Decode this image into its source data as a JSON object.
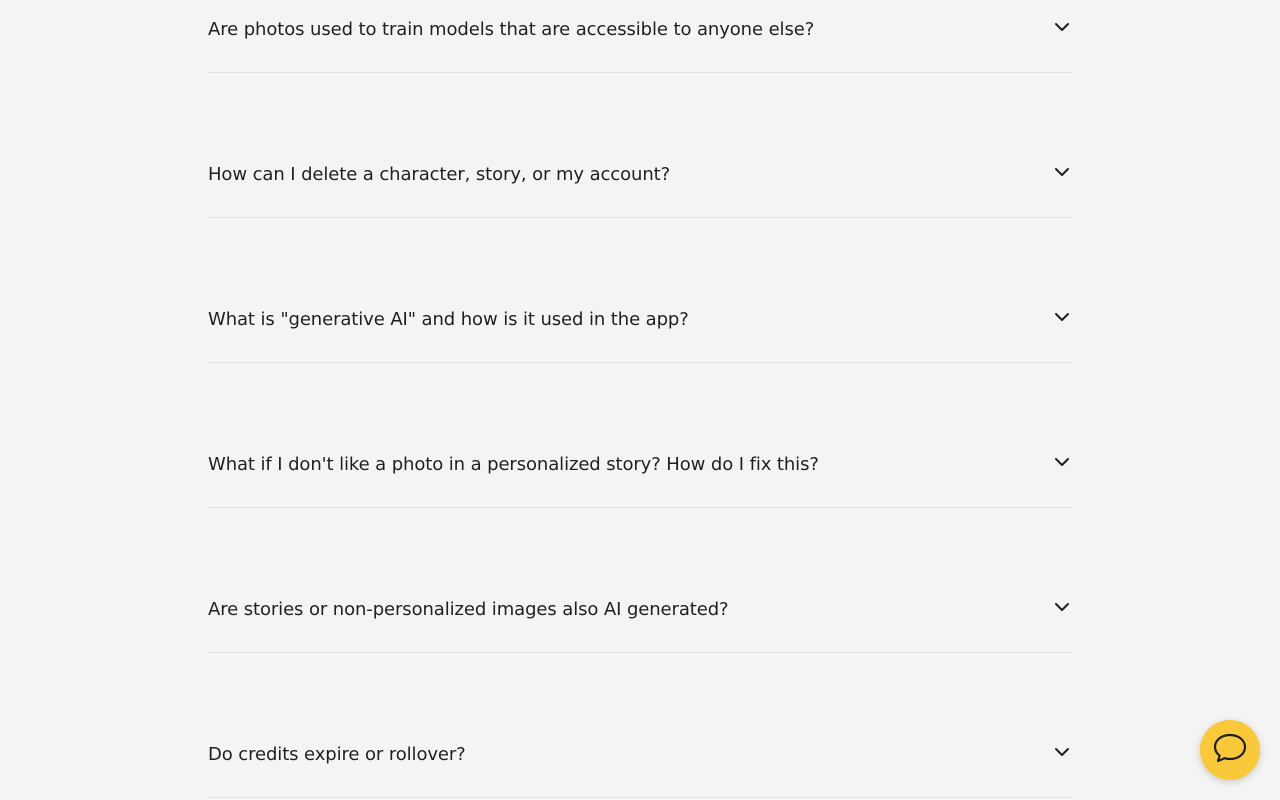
{
  "faq": {
    "items": [
      {
        "question": "Are photos used to train models that are accessible to anyone else?",
        "icon": "chevron-down-icon"
      },
      {
        "question": "How can I delete a character, story, or my account?",
        "icon": "chevron-down-icon"
      },
      {
        "question": "What is \"generative AI\" and how is it used in the app?",
        "icon": "chevron-down-icon"
      },
      {
        "question": "What if I don't like a photo in a personalized story? How do I fix this?",
        "icon": "chevron-down-icon"
      },
      {
        "question": "Are stories or non-personalized images also AI generated?",
        "icon": "chevron-down-icon"
      },
      {
        "question": "Do credits expire or rollover?",
        "icon": "chevron-down-icon"
      }
    ]
  },
  "chat_widget": {
    "icon": "chat-bubble-icon",
    "color": "#f9c93a"
  },
  "colors": {
    "background": "#f4f4f4",
    "divider": "#e2e2e2",
    "text": "#1f1f1f",
    "accent": "#f9c93a"
  }
}
